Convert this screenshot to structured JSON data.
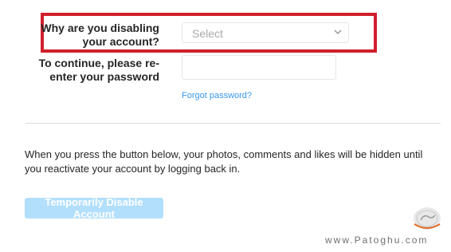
{
  "form": {
    "reason_label": "Why are you disabling your account?",
    "reason_select_value": "Select",
    "password_label": "To continue, please re-enter your password",
    "password_value": "",
    "forgot_password_link": "Forgot password?"
  },
  "info": {
    "text": "When you press the button below, your photos, comments and likes will be hidden until you reactivate your account by logging back in."
  },
  "actions": {
    "disable_button_label": "Temporarily Disable Account"
  },
  "watermark": {
    "text": "www.Patoghu.com"
  },
  "colors": {
    "highlight_border": "#d01f2c",
    "link": "#3897f0",
    "button_disabled_bg": "#b2dffc"
  },
  "icons": {
    "select_chevron": "chevron-down-icon",
    "watermark_logo": "patoghu-logo-icon"
  }
}
